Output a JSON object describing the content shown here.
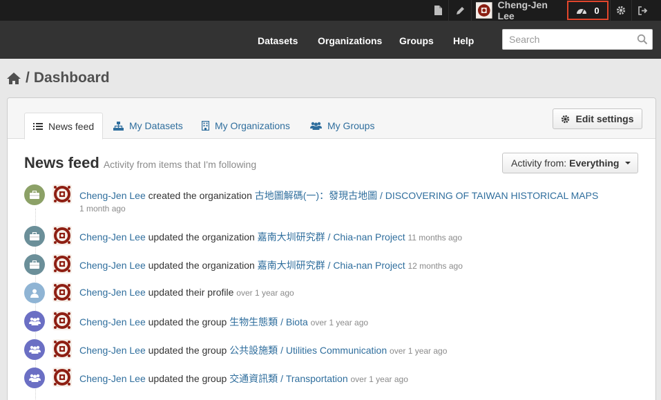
{
  "account": {
    "user_name": "Cheng-Jen Lee",
    "dashboard_count": "0",
    "highlight_color": "#e2462c"
  },
  "nav": {
    "items": [
      "Datasets",
      "Organizations",
      "Groups",
      "Help"
    ]
  },
  "search": {
    "placeholder": "Search"
  },
  "breadcrumb": {
    "separator": "/",
    "page": "Dashboard"
  },
  "tabs": [
    {
      "label": "News feed",
      "icon": "list-icon",
      "active": true
    },
    {
      "label": "My Datasets",
      "icon": "sitemap-icon",
      "active": false
    },
    {
      "label": "My Organizations",
      "icon": "building-icon",
      "active": false
    },
    {
      "label": "My Groups",
      "icon": "group-icon",
      "active": false
    }
  ],
  "edit_settings_label": "Edit settings",
  "feed": {
    "title": "News feed",
    "subtitle": "Activity from items that I'm following",
    "activity_from_label": "Activity from:",
    "activity_from_value": "Everything"
  },
  "activities": [
    {
      "icon": "briefcase-icon",
      "color": "#8ca167",
      "actor": "Cheng-Jen Lee",
      "verb": "created the organization",
      "object": "古地圖解碼(一)：發現古地圖 / DISCOVERING OF TAIWAN HISTORICAL MAPS",
      "date": "1 month ago"
    },
    {
      "icon": "briefcase-icon",
      "color": "#6b8f99",
      "actor": "Cheng-Jen Lee",
      "verb": "updated the organization",
      "object": "嘉南大圳研究群 / Chia-nan Project",
      "date": "11 months ago"
    },
    {
      "icon": "briefcase-icon",
      "color": "#6b8f99",
      "actor": "Cheng-Jen Lee",
      "verb": "updated the organization",
      "object": "嘉南大圳研究群 / Chia-nan Project",
      "date": "12 months ago"
    },
    {
      "icon": "user-icon",
      "color": "#8fb4d4",
      "actor": "Cheng-Jen Lee",
      "verb": "updated their profile",
      "object": "",
      "date": "over 1 year ago"
    },
    {
      "icon": "group-icon",
      "color": "#6b6fc4",
      "actor": "Cheng-Jen Lee",
      "verb": "updated the group",
      "object": "生物生態類 / Biota",
      "date": "over 1 year ago"
    },
    {
      "icon": "group-icon",
      "color": "#6b6fc4",
      "actor": "Cheng-Jen Lee",
      "verb": "updated the group",
      "object": "公共設施類 / Utilities Communication",
      "date": "over 1 year ago"
    },
    {
      "icon": "group-icon",
      "color": "#6b6fc4",
      "actor": "Cheng-Jen Lee",
      "verb": "updated the group",
      "object": "交通資訊類 / Transportation",
      "date": "over 1 year ago"
    }
  ]
}
